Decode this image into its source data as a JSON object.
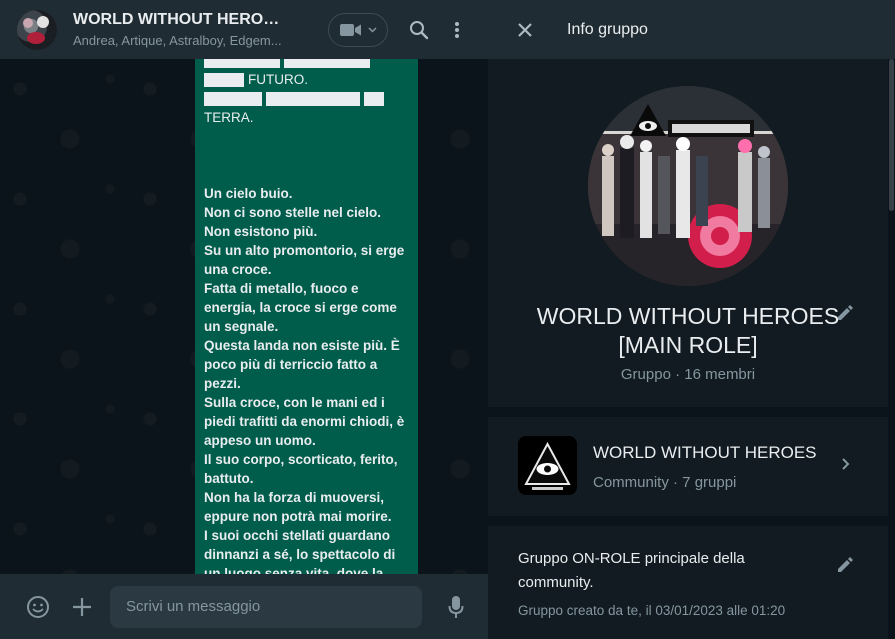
{
  "chat": {
    "title": "WORLD WITHOUT HEROES...",
    "participants": "Andrea, Artique, Astralboy, Edgem...",
    "message": {
      "header_lines": [
        "FUTURO.",
        "TERRA."
      ],
      "body": "Un cielo buio.\nNon ci sono stelle nel cielo.\nNon esistono più.\nSu un alto promontorio, si erge una croce.\nFatta di metallo, fuoco e energia, la croce si erge come un segnale.\nQuesta landa non esiste più. È poco più di terriccio fatto a pezzi.\nSulla croce, con le mani ed i piedi trafitti da enormi chiodi, è appeso un uomo.\nIl suo corpo, scorticato, ferito, battuto.\nNon ha la forza di muoversi, eppure non potrà mai morire.\nI suoi occhi stellati guardano dinnanzi a sé, lo spettacolo di un luogo senza vita, dove la"
    },
    "composer": {
      "placeholder": "Scrivi un messaggio"
    },
    "icons": {
      "video": "video-camera-icon",
      "search": "search-icon",
      "menu": "menu-dots-icon",
      "emoji": "emoji-icon",
      "attach": "plus-icon",
      "mic": "microphone-icon",
      "scroll": "chevron-down-icon"
    }
  },
  "info": {
    "header_title": "Info gruppo",
    "group_name": "WORLD WITHOUT HEROES [MAIN ROLE]",
    "group_meta": "Gruppo · 16 membri",
    "community": {
      "name": "WORLD WITHOUT HEROES",
      "meta": "Community · 7 gruppi"
    },
    "description": "Gruppo ON-ROLE principale della community.",
    "created": "Gruppo creato da te, il 03/01/2023 alle 01:20"
  },
  "colors": {
    "background": "#0b141a",
    "panel": "#111b21",
    "header": "#202c33",
    "outgoing_bubble": "#005c4b",
    "text_primary": "#e9edef",
    "text_secondary": "#8696a0"
  }
}
